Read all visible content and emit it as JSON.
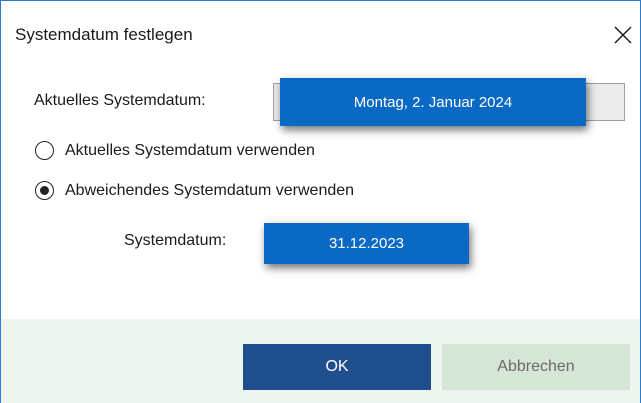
{
  "dialog": {
    "title": "Systemdatum festlegen",
    "close_icon": "close-icon"
  },
  "current": {
    "label": "Aktuelles Systemdatum:",
    "value": "Montag, 2. Januar 2024"
  },
  "options": [
    {
      "label": "Aktuelles Systemdatum verwenden",
      "checked": false
    },
    {
      "label": "Abweichendes Systemdatum verwenden",
      "checked": true
    }
  ],
  "system_date": {
    "label": "Systemdatum:",
    "value": "31.12.2023"
  },
  "buttons": {
    "ok": "OK",
    "cancel": "Abbrechen"
  },
  "colors": {
    "accent": "#0a69c4",
    "ok_button": "#1f4f8c",
    "cancel_button": "#d6e6d6",
    "footer_bg": "#eef4ef",
    "window_border": "#2b7bd1"
  }
}
